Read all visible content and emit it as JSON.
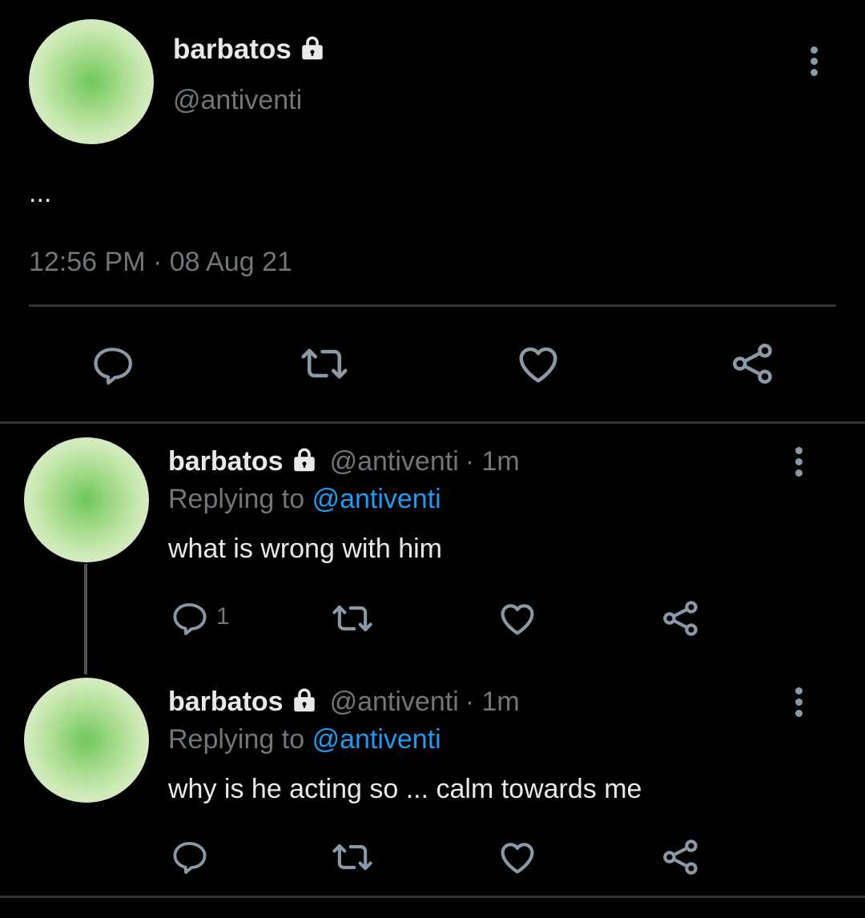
{
  "main_tweet": {
    "display_name": "barbatos",
    "handle": "@antiventi",
    "text": "...",
    "timestamp": "12:56 PM · 08 Aug 21",
    "actions": [
      "reply-icon",
      "retweet-icon",
      "like-icon",
      "share-icon"
    ]
  },
  "replies": [
    {
      "display_name": "barbatos",
      "handle": "@antiventi",
      "time": "· 1m",
      "replying_prefix": "Replying to",
      "replying_to": "@antiventi",
      "text": "what is wrong with him",
      "reply_count": "1"
    },
    {
      "display_name": "barbatos",
      "handle": "@antiventi",
      "time": "· 1m",
      "replying_prefix": "Replying to",
      "replying_to": "@antiventi",
      "text": "why is he acting so ... calm towards me",
      "reply_count": ""
    }
  ],
  "colors": {
    "background": "#000000",
    "text": "#e7e9ea",
    "muted": "#71767b",
    "link": "#1d9bf0",
    "separator": "#2f3336"
  }
}
